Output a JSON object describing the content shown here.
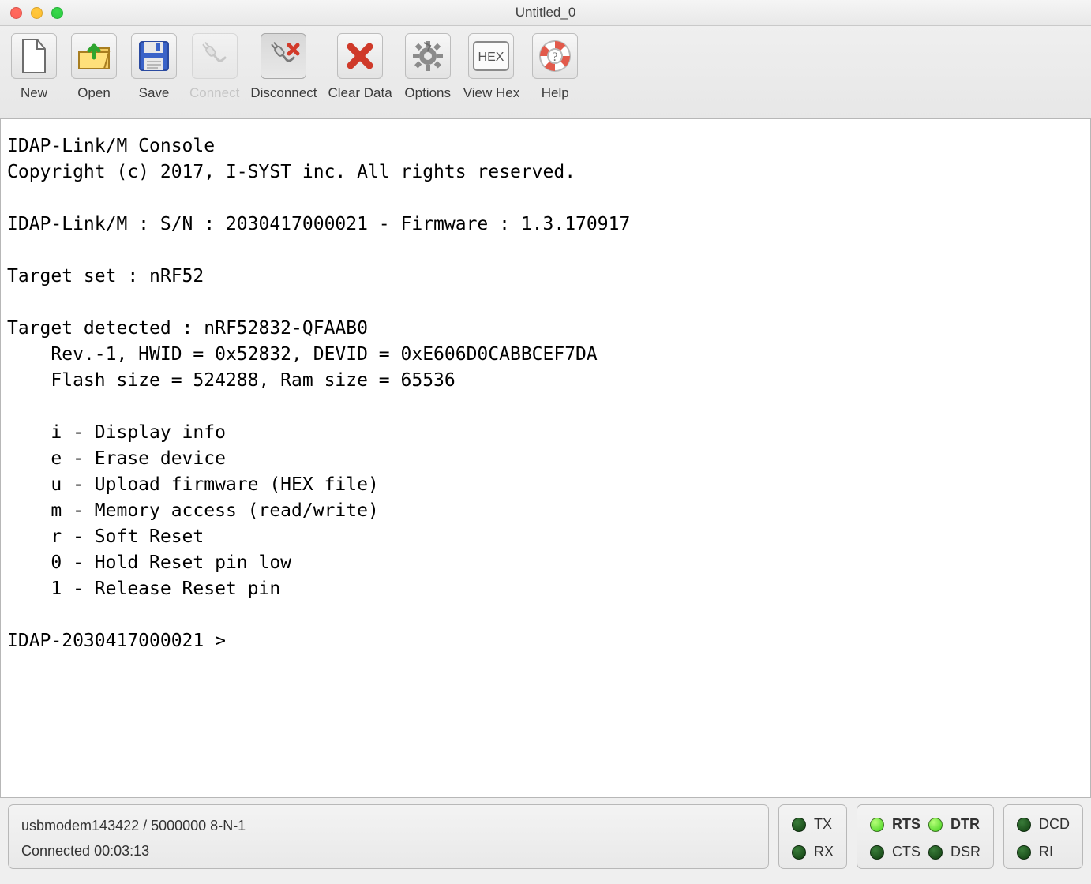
{
  "window": {
    "title": "Untitled_0"
  },
  "toolbar": {
    "new": "New",
    "open": "Open",
    "save": "Save",
    "connect": "Connect",
    "disconnect": "Disconnect",
    "clear_data": "Clear Data",
    "options": "Options",
    "view_hex": "View Hex",
    "help": "Help"
  },
  "terminal": {
    "lines": [
      "IDAP-Link/M Console",
      "Copyright (c) 2017, I-SYST inc. All rights reserved.",
      "",
      "IDAP-Link/M : S/N : 2030417000021 - Firmware : 1.3.170917",
      "",
      "Target set : nRF52",
      "",
      "Target detected : nRF52832-QFAAB0",
      "    Rev.-1, HWID = 0x52832, DEVID = 0xE606D0CABBCEF7DA",
      "    Flash size = 524288, Ram size = 65536",
      "",
      "    i - Display info",
      "    e - Erase device",
      "    u - Upload firmware (HEX file)",
      "    m - Memory access (read/write)",
      "    r - Soft Reset",
      "    0 - Hold Reset pin low",
      "    1 - Release Reset pin",
      "",
      "IDAP-2030417000021 > "
    ]
  },
  "status": {
    "port_line": "usbmodem143422 / 5000000 8-N-1",
    "conn_line": "Connected 00:03:13",
    "txrx": {
      "TX": "TX",
      "RX": "RX"
    },
    "signals": {
      "RTS": "RTS",
      "CTS": "CTS",
      "DTR": "DTR",
      "DSR": "DSR"
    },
    "dcd_ri": {
      "DCD": "DCD",
      "RI": "RI"
    }
  },
  "icons": {
    "hex_label": "HEX"
  }
}
